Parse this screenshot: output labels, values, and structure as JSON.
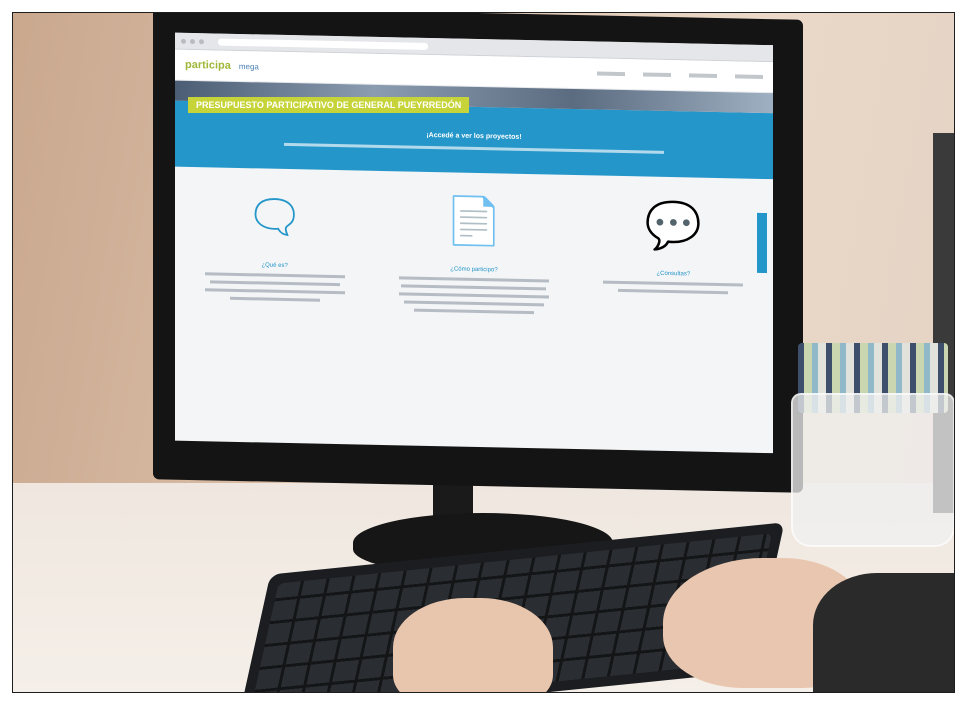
{
  "browser": {
    "site_logo": "participa",
    "site_logo_sub": "mega"
  },
  "page": {
    "banner": "PRESUPUESTO PARTICIPATIVO DE GENERAL PUEYRREDÓN",
    "cta": "¡Accedé a ver los proyectos!",
    "columns": [
      {
        "title": "¿Qué es?",
        "icon": "chat-question-icon"
      },
      {
        "title": "¿Cómo participo?",
        "icon": "document-click-icon"
      },
      {
        "title": "¿Consultas?",
        "icon": "chat-bubble-icon"
      }
    ]
  },
  "colors": {
    "accent_blue": "#2596c9",
    "accent_green": "#c6d43a"
  }
}
